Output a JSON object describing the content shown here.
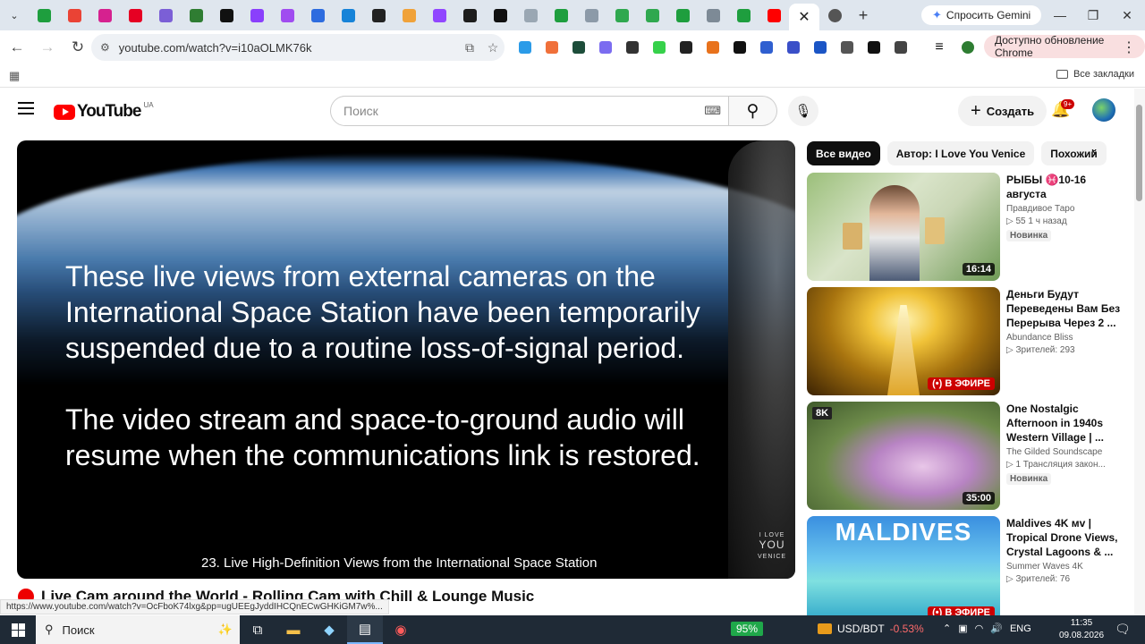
{
  "browser": {
    "gemini_button": "Спросить Gemini",
    "url": "youtube.com/watch?v=i10aOLMK76k",
    "update_label": "Доступно обновление Chrome",
    "all_bookmarks": "Все закладки",
    "tab_favicons": [
      {
        "icon": "green-tab-icon",
        "color": "#1e9e3e"
      },
      {
        "icon": "gmail-icon",
        "color": "#ea4335"
      },
      {
        "icon": "heart-icon",
        "color": "#d6218f"
      },
      {
        "icon": "pinterest-icon",
        "color": "#e60023"
      },
      {
        "icon": "colorful-circle-icon",
        "color": "#7b5fd6"
      },
      {
        "icon": "r-icon",
        "color": "#2f7d32"
      },
      {
        "icon": "co-icon",
        "color": "#111111"
      },
      {
        "icon": "purple-a-icon",
        "color": "#8a3ffc"
      },
      {
        "icon": "purple-a-icon",
        "color": "#a04cf0"
      },
      {
        "icon": "at-icon",
        "color": "#2d6cdf"
      },
      {
        "icon": "chat-icon",
        "color": "#1683d8"
      },
      {
        "icon": "box-icon",
        "color": "#222222"
      },
      {
        "icon": "d-icon",
        "color": "#f0a23a"
      },
      {
        "icon": "twitch-icon",
        "color": "#9146ff"
      },
      {
        "icon": "k-icon",
        "color": "#1d1d1d"
      },
      {
        "icon": "co-icon",
        "color": "#111111"
      },
      {
        "icon": "m-icon",
        "color": "#9aa7b3"
      },
      {
        "icon": "green-tab-icon",
        "color": "#1e9e3e"
      },
      {
        "icon": "globe-icon",
        "color": "#8c9aa8"
      },
      {
        "icon": "green-circle-icon",
        "color": "#2fa84f"
      },
      {
        "icon": "green-circle-icon",
        "color": "#2fa84f"
      },
      {
        "icon": "green-tab-icon",
        "color": "#1e9e3e"
      },
      {
        "icon": "globe-icon",
        "color": "#7d8a96"
      },
      {
        "icon": "green-tab-icon",
        "color": "#1e9e3e"
      },
      {
        "icon": "youtube-icon",
        "color": "#ff0000"
      }
    ],
    "active_tab_symbol": "✕",
    "after_tab_icon": "refresh-circle-icon",
    "extensions": [
      {
        "icon": "s-ext-icon",
        "color": "#2b9be8"
      },
      {
        "icon": "wave-ext-icon",
        "color": "#f0703a"
      },
      {
        "icon": "hash-ext-icon",
        "color": "#1d4d3a"
      },
      {
        "icon": "cloud-ext-icon",
        "color": "#7b6cf0"
      },
      {
        "icon": "chart-ext-icon",
        "color": "#333333"
      },
      {
        "icon": "cross-ext-icon",
        "color": "#36d14a"
      },
      {
        "icon": "gear-ext-icon",
        "color": "#222222"
      },
      {
        "icon": "fox-ext-icon",
        "color": "#e8721c"
      },
      {
        "icon": "grid-ext-icon",
        "color": "#111111"
      },
      {
        "icon": "wrench-ext-icon",
        "color": "#2f5fd0"
      },
      {
        "icon": "person-ext-icon",
        "color": "#3a4fc8"
      },
      {
        "icon": "shield-ext-icon",
        "color": "#1b55c5"
      },
      {
        "icon": "bird-ext-icon",
        "color": "#555555"
      },
      {
        "icon": "a-ext-icon",
        "color": "#111111"
      },
      {
        "icon": "puzzle-ext-icon",
        "color": "#444444"
      }
    ]
  },
  "youtube": {
    "logo_text": "YouTube",
    "logo_region": "UA",
    "search_placeholder": "Поиск",
    "create_label": "Создать",
    "notif_count": "9+",
    "player": {
      "message_1": "These live views from external cameras on the International Space Station have been temporarily suspended due to a routine loss-of-signal period.",
      "message_2": "The video stream and space-to-ground audio will resume when the communications link is restored.",
      "caption": "23. Live High-Definition Views from the International Space Station",
      "watermark_top": "I LOVE",
      "watermark_mid": "YOU",
      "watermark_bottom": "VENICE"
    },
    "video_title": "Live Cam around the World - Rolling Cam with Chill & Lounge Music",
    "status_url": "https://www.youtube.com/watch?v=OcFboK74lxg&pp=ugUEEgJyddIHCQnECwGHKiGM7w%...",
    "chips": [
      "Все видео",
      "Автор: I Love You Venice",
      "Похожий"
    ],
    "related": [
      {
        "title": "РЫБЫ ♓10-16 августа",
        "channel": "Правдивое Таро",
        "meta": "▷ 55   1 ч назад",
        "badge": "Новинка",
        "overlay": "16:14",
        "overlay_type": "duration"
      },
      {
        "title": "Деньги Будут Переведены Вам Без Перерыва Через 2 ...",
        "channel": "Abundance Bliss",
        "meta": "▷ Зрителей: 293",
        "badge": "",
        "overlay": "(•) В ЭФИРЕ",
        "overlay_type": "live"
      },
      {
        "title": "One Nostalgic Afternoon in 1940s Western Village | ...",
        "channel": "The Gilded Soundscape",
        "meta": "▷ 1   Трансляция закон...",
        "badge": "Новинка",
        "overlay": "35:00",
        "overlay_type": "duration",
        "thumb_tag": "8K"
      },
      {
        "title": "Maldives 4K ᴍᴠ | Tropical Drone Views, Crystal Lagoons & ...",
        "channel": "Summer Waves 4K",
        "meta": "▷ Зрителей: 76",
        "badge": "",
        "overlay": "(•) В ЭФИРЕ",
        "overlay_type": "live",
        "thumb_tag": "MALDIVES"
      }
    ]
  },
  "taskbar": {
    "search_label": "Поиск",
    "battery": "95%",
    "currency": "USD/BDT",
    "currency_change": "-0.53%",
    "lang": "ENG",
    "time": "11:35",
    "date": "09.08.2026"
  },
  "colors": {
    "youtube_red": "#ff0000",
    "live_red": "#cc0000",
    "tabstrip": "#dfe6ee",
    "taskbar": "#1f2a36",
    "battery_green": "#1fa84a"
  }
}
